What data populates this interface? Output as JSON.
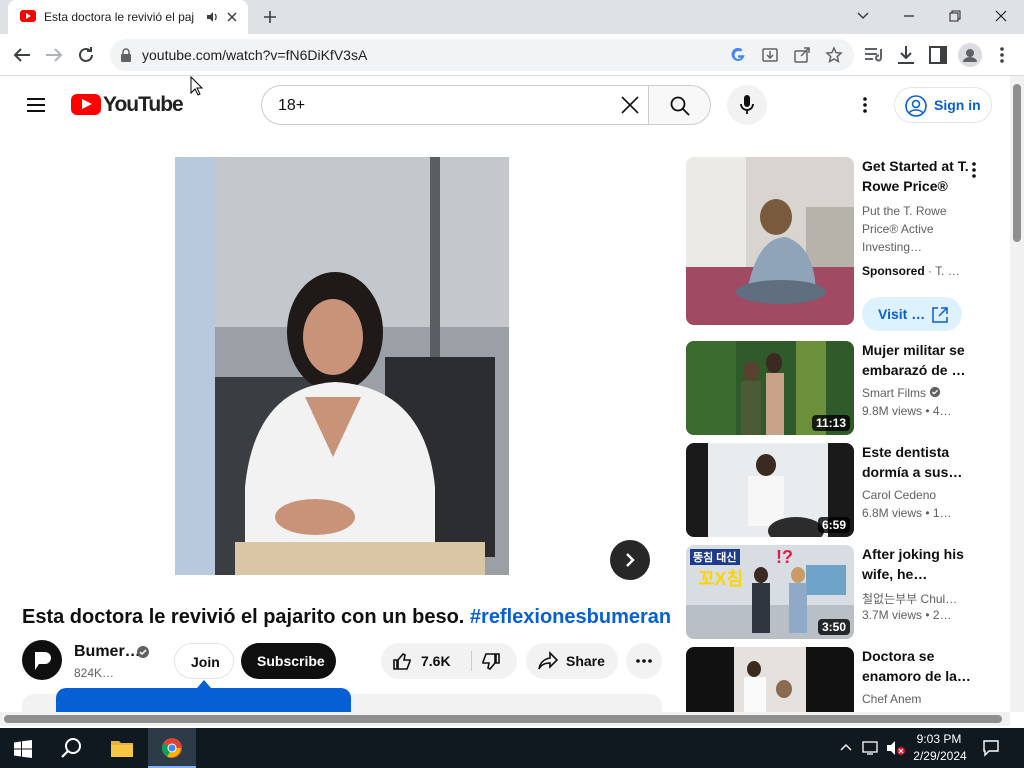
{
  "browser": {
    "tab_title": "Esta doctora le revivió el pajarito",
    "url": "youtube.com/watch?v=fN6DiKfV3sA"
  },
  "youtube": {
    "logo_text": "YouTube",
    "search_value": "18+",
    "sign_in_label": "Sign in",
    "video": {
      "title_main": "Esta doctora le revivió el pajarito con un beso.",
      "title_tag": "#reflexionesbumeran",
      "channel_name": "Bumer…",
      "subscribers": "824K…",
      "join_label": "Join",
      "subscribe_label": "Subscribe",
      "likes": "7.6K",
      "share_label": "Share"
    },
    "sponsored": {
      "title": "Get Started at T. Rowe Price®",
      "description": "Put the T. Rowe Price® Active Investing…",
      "sponsored_label": "Sponsored",
      "advertiser": "· T. …",
      "visit_label": "Visit …"
    },
    "related": [
      {
        "title": "Mujer militar se embarazó de …",
        "channel": "Smart Films",
        "meta": "9.8M views  • 4…",
        "duration": "11:13",
        "verified": true
      },
      {
        "title": "Este dentista dormía a sus…",
        "channel": "Carol Cedeno",
        "meta": "6.8M views  • 1…",
        "duration": "6:59",
        "verified": false
      },
      {
        "title": "After joking his wife, he…",
        "channel": "철없는부부 Chul…",
        "meta": "3.7M views  • 2…",
        "duration": "3:50",
        "verified": false,
        "thumb_text_1": "뚱침 대신",
        "thumb_text_2": "꼬X침",
        "thumb_text_3": "!?"
      },
      {
        "title": "Doctora se enamoro de la…",
        "channel": "Chef Anem",
        "meta": "",
        "duration": "",
        "verified": false
      }
    ]
  },
  "taskbar": {
    "time": "9:03 PM",
    "date": "2/29/2024"
  },
  "colors": {
    "youtube_red": "#ff0000",
    "link_blue": "#065fd4",
    "taskbar": "#101820"
  }
}
